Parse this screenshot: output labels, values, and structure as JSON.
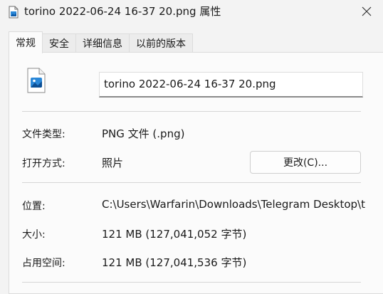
{
  "window": {
    "title": "torino 2022-06-24 16-37 20.png 属性"
  },
  "tabs": [
    {
      "label": "常规"
    },
    {
      "label": "安全"
    },
    {
      "label": "详细信息"
    },
    {
      "label": "以前的版本"
    }
  ],
  "general": {
    "file_name": "torino 2022-06-24 16-37 20.png",
    "type_label": "文件类型:",
    "type_value": "PNG 文件 (.png)",
    "opens_with_label": "打开方式:",
    "opens_with_value": "照片",
    "change_button": "更改(C)...",
    "location_label": "位置:",
    "location_value": "C:\\Users\\Warfarin\\Downloads\\Telegram Desktop\\torino",
    "size_label": "大小:",
    "size_value": "121 MB (127,041,052 字节)",
    "size_on_disk_label": "占用空间:",
    "size_on_disk_value": "121 MB (127,041,536 字节)"
  },
  "icons": {
    "title": "file-image-icon",
    "close": "close-icon",
    "file": "png-file-icon"
  },
  "colors": {
    "accent": "#1a73c8",
    "background": "#f3f3f3",
    "panel": "#fbfbfb"
  }
}
